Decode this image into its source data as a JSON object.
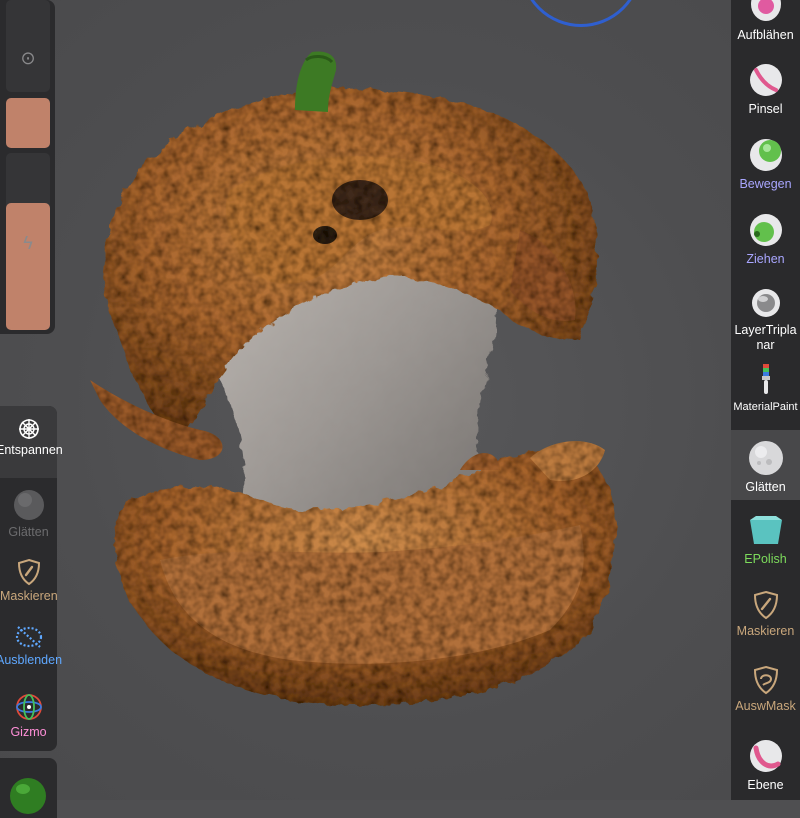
{
  "viewport": {
    "brush_ring_color": "#2f5fcf",
    "model": "pumpkin-sculpt"
  },
  "left_panel": {
    "slots": [
      {
        "icon": "target-icon"
      },
      {
        "icon": "color-swatch",
        "color": "#c0826a"
      },
      {
        "icon": "lightning-icon",
        "color": "#c0826a"
      }
    ],
    "tools": [
      {
        "label": "Entspannen",
        "icon": "spiderweb-icon",
        "color": "#ffffff"
      },
      {
        "label": "Glätten",
        "icon": "smooth-sphere-icon",
        "color": "#6c6c6e"
      },
      {
        "label": "Maskieren",
        "icon": "mask-shield-icon",
        "color": "#c9a77c"
      },
      {
        "label": "Ausblenden",
        "icon": "dotted-hide-icon",
        "color": "#5fa8ff"
      },
      {
        "label": "Gizmo",
        "icon": "gizmo-icon",
        "color": "#ff8fd8"
      }
    ]
  },
  "right_toolbar": {
    "tools": [
      {
        "label": "Aufblähen",
        "icon": "inflate-sphere-icon",
        "color": "#ffffff"
      },
      {
        "label": "Pinsel",
        "icon": "brush-sphere-icon",
        "color": "#ffffff"
      },
      {
        "label": "Bewegen",
        "icon": "move-sphere-icon",
        "color": "#a9a6ff"
      },
      {
        "label": "Ziehen",
        "icon": "drag-sphere-icon",
        "color": "#a9a6ff"
      },
      {
        "label": "LayerTriplanar",
        "icon": "layer-sphere-icon",
        "color": "#ffffff"
      },
      {
        "label": "MaterialPaint",
        "icon": "paint-brush-icon",
        "color": "#ffffff"
      },
      {
        "label": "Glätten",
        "icon": "smooth-sphere-icon",
        "color": "#ffffff",
        "selected": true
      },
      {
        "label": "EPolish",
        "icon": "epolish-icon",
        "color": "#7ddc5c"
      },
      {
        "label": "Maskieren",
        "icon": "mask-shield-icon",
        "color": "#c9a77c"
      },
      {
        "label": "AuswMask",
        "icon": "select-mask-icon",
        "color": "#c9a77c"
      },
      {
        "label": "Ebene",
        "icon": "layer-sphere-pink-icon",
        "color": "#ffffff"
      }
    ]
  }
}
